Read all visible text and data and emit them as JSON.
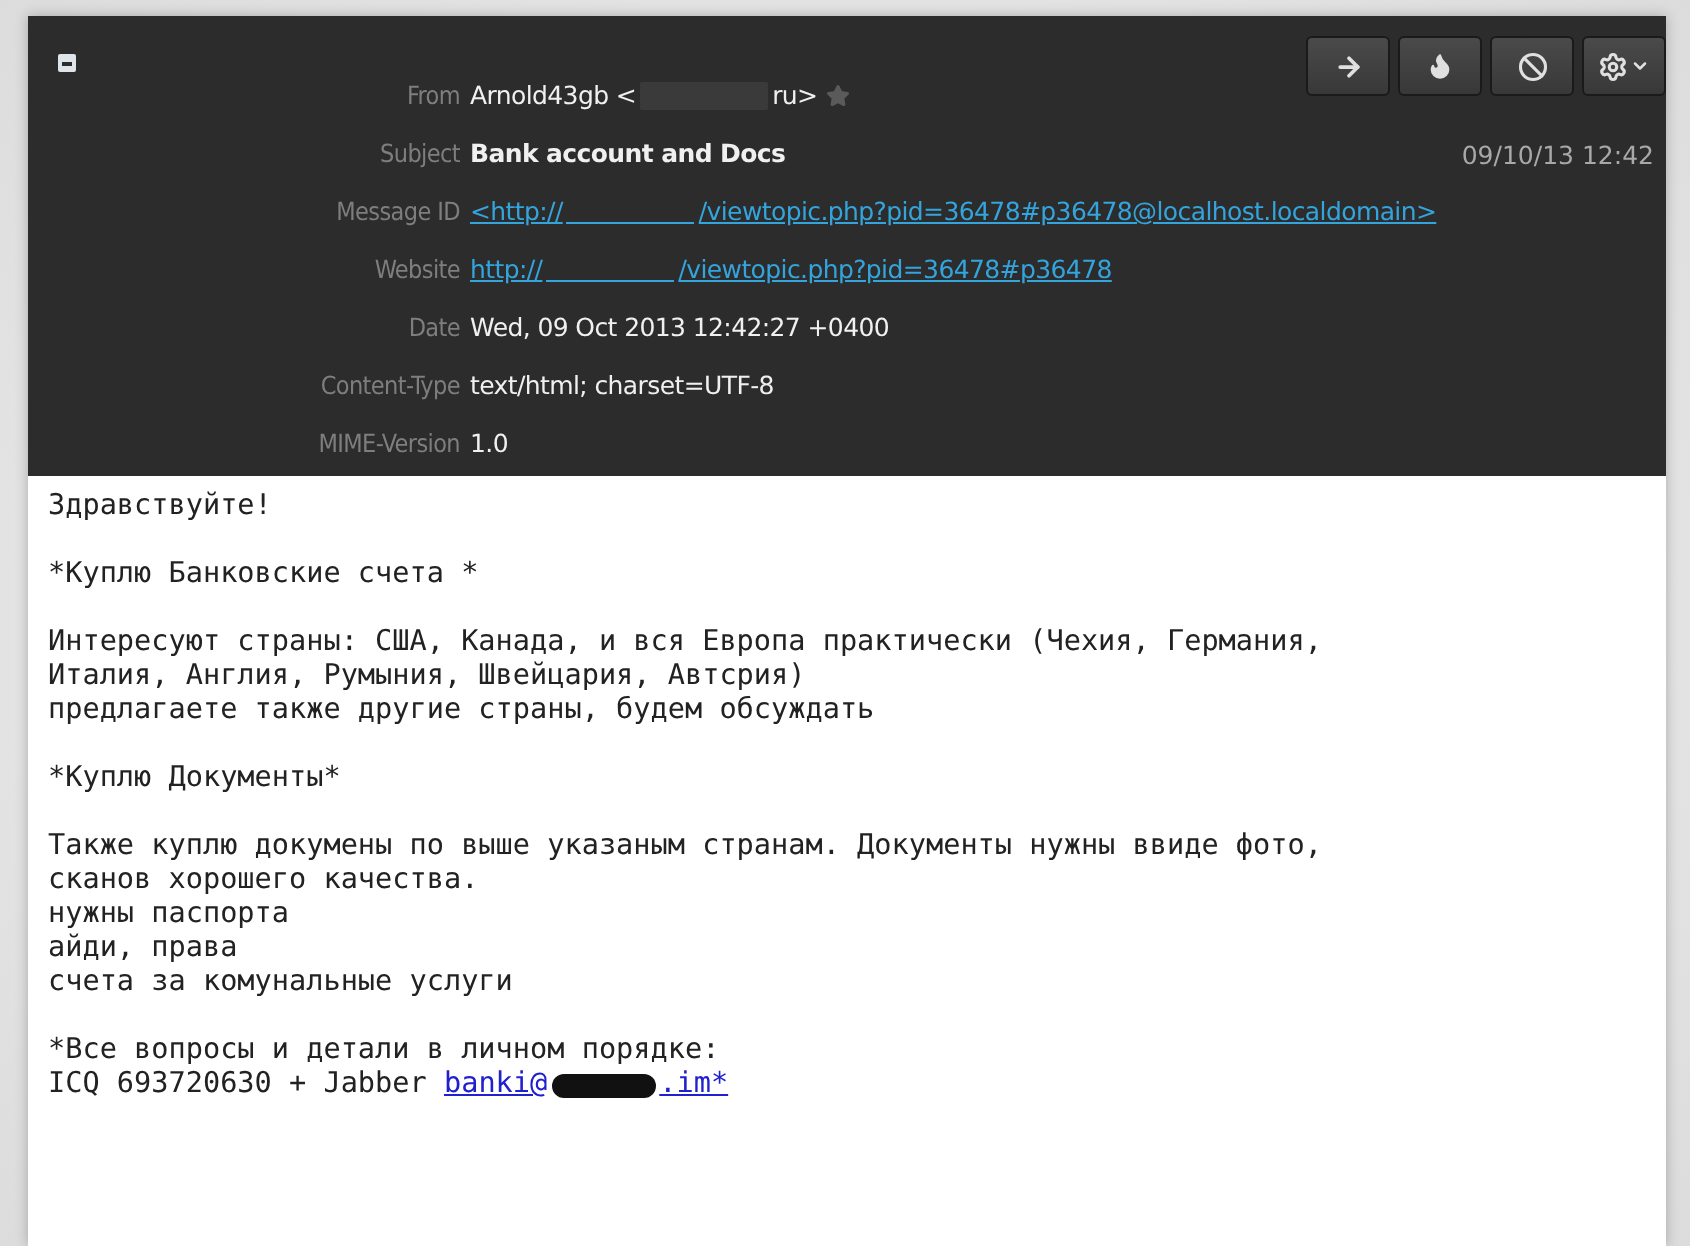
{
  "header": {
    "buttons": [
      {
        "kind": "forward"
      },
      {
        "kind": "flame"
      },
      {
        "kind": "block"
      },
      {
        "kind": "settings"
      }
    ],
    "received": "09/10/13 12:42",
    "fields": [
      {
        "label": "From",
        "kind": "sender",
        "parts": [
          "Arnold43gb <",
          "ru>"
        ],
        "starred": false
      },
      {
        "label": "Subject",
        "kind": "bold",
        "value": "Bank account and Docs"
      },
      {
        "label": "Message ID",
        "kind": "link",
        "parts": [
          "<http://",
          "/viewtopic.php?pid=36478#p36478@localhost.localdomain>"
        ]
      },
      {
        "label": "Website",
        "kind": "link",
        "parts": [
          "http://",
          "/viewtopic.php?pid=36478#p36478"
        ]
      },
      {
        "label": "Date",
        "kind": "plain",
        "value": "Wed, 09 Oct 2013 12:42:27 +0400"
      },
      {
        "label": "Content-Type",
        "kind": "plain",
        "value": "text/html; charset=UTF-8"
      },
      {
        "label": "MIME-Version",
        "kind": "plain",
        "value": "1.0"
      }
    ]
  },
  "body": {
    "paragraphs": [
      [
        "Здравствуйте!"
      ],
      [
        "*Куплю Банковские счета *"
      ],
      [
        "Интересуют страны: США, Канада, и вся Европа практически (Чехия, Германия,",
        "Италия, Англия, Румыния, Швейцария, Автсрия)",
        "предлагаете также другие страны, будем обсуждать"
      ],
      [
        "*Куплю Документы*"
      ],
      [
        "Также куплю докумены по выше указаным странам. Документы нужны ввиде фото,",
        "сканов хорошего качества.",
        "нужны паспорта",
        "айди, права",
        "счета за комунальные услуги"
      ],
      [
        "*Все вопросы и детали в личном порядке:"
      ]
    ],
    "contact": {
      "text": "ICQ 693720630 + Jabber ",
      "link_parts": [
        "banki@",
        ".im*"
      ]
    }
  }
}
